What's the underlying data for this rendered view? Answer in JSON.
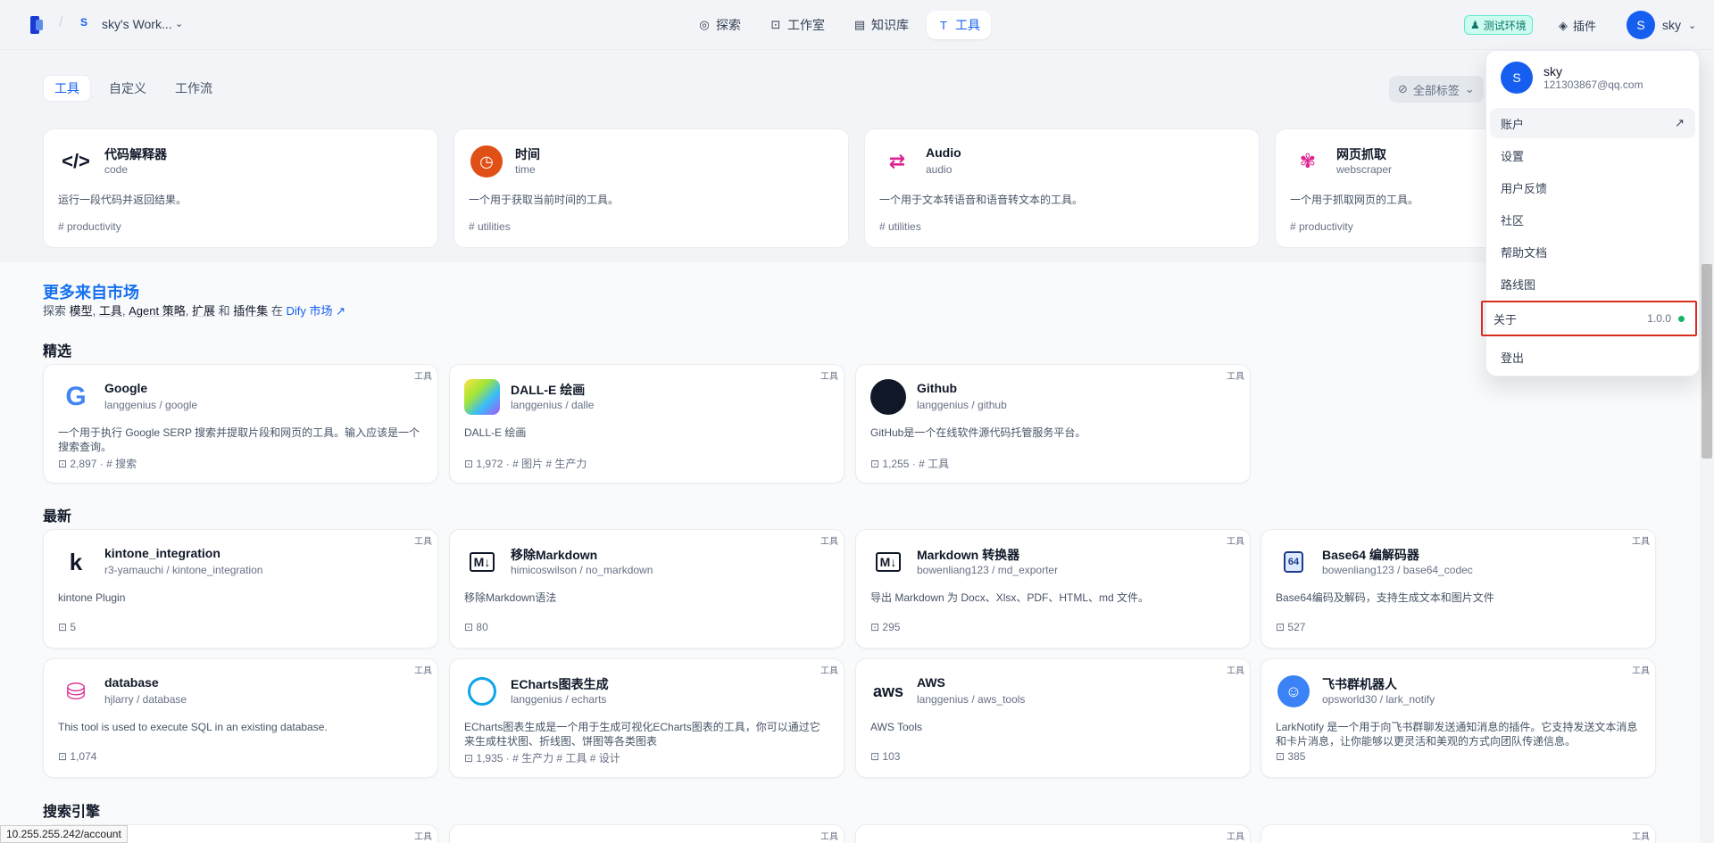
{
  "header": {
    "workspace_badge": "S",
    "workspace_name": "sky's Work...",
    "nav": [
      {
        "label": "探索",
        "icon": "explore-icon"
      },
      {
        "label": "工作室",
        "icon": "robot-icon"
      },
      {
        "label": "知识库",
        "icon": "book-icon"
      },
      {
        "label": "工具",
        "icon": "tool-icon"
      }
    ],
    "env_badge": "测试环境",
    "plugins_label": "插件",
    "user_initial": "S",
    "user_name": "sky"
  },
  "tabs": [
    "工具",
    "自定义",
    "工作流"
  ],
  "tag_filter": "全部标签",
  "installed_tools": [
    {
      "title": "代码解释器",
      "sub": "code",
      "desc": "运行一段代码并返回结果。",
      "tag": "# productivity",
      "icon": "</>",
      "color": "#101828"
    },
    {
      "title": "时间",
      "sub": "time",
      "desc": "一个用于获取当前时间的工具。",
      "tag": "# utilities",
      "icon": "◷",
      "color": "#e04f16"
    },
    {
      "title": "Audio",
      "sub": "audio",
      "desc": "一个用于文本转语音和语音转文本的工具。",
      "tag": "# utilities",
      "icon": "⇄",
      "color": "#dd2590"
    },
    {
      "title": "网页抓取",
      "sub": "webscraper",
      "desc": "一个用于抓取网页的工具。",
      "tag": "# productivity",
      "icon": "✾",
      "color": "#dd2590"
    }
  ],
  "market": {
    "title": "更多来自市场",
    "desc_prefix": "探索",
    "k1": "模型",
    "k2": "工具",
    "k3": "Agent 策略",
    "k4": "扩展",
    "and": "和",
    "k5": "插件集",
    "in": "在",
    "link": "Dify 市场 ↗",
    "sections": [
      "精选",
      "最新",
      "搜索引擎"
    ]
  },
  "featured": [
    {
      "title": "Google",
      "sub": "langgenius / google",
      "desc": "一个用于执行 Google SERP 搜索并提取片段和网页的工具。输入应该是一个搜索查询。",
      "meta": "⊡ 2,897 · # 搜索",
      "corner": "工具",
      "icon": "G",
      "color": "#4285f4"
    },
    {
      "title": "DALL-E 绘画",
      "sub": "langgenius / dalle",
      "desc": "DALL-E 绘画",
      "meta": "⊡ 1,972 · # 图片 # 生产力",
      "corner": "工具",
      "icon": "",
      "color": "#a3e635"
    },
    {
      "title": "Github",
      "sub": "langgenius / github",
      "desc": "GitHub是一个在线软件源代码托管服务平台。",
      "meta": "⊡ 1,255 · # 工具",
      "corner": "工具",
      "icon": "●",
      "color": "#101828"
    }
  ],
  "latest": [
    {
      "title": "kintone_integration",
      "sub": "r3-yamauchi / kintone_integration",
      "desc": "kintone Plugin",
      "meta": "⊡ 5",
      "corner": "工具",
      "icon": "k",
      "color": "#101828"
    },
    {
      "title": "移除Markdown",
      "sub": "himicoswilson / no_markdown",
      "desc": "移除Markdown语法",
      "meta": "⊡ 80",
      "corner": "工具",
      "icon": "M↓",
      "color": "#101828"
    },
    {
      "title": "Markdown 转换器",
      "sub": "bowenliang123 / md_exporter",
      "desc": "导出 Markdown 为 Docx、Xlsx、PDF、HTML、md 文件。",
      "meta": "⊡ 295",
      "corner": "工具",
      "icon": "M↓",
      "color": "#101828"
    },
    {
      "title": "Base64 编解码器",
      "sub": "bowenliang123 / base64_codec",
      "desc": "Base64编码及解码，支持生成文本和图片文件",
      "meta": "⊡ 527",
      "corner": "工具",
      "icon": "64",
      "color": "#1d4ed8"
    },
    {
      "title": "database",
      "sub": "hjlarry / database",
      "desc": "This tool is used to execute SQL in an existing database.",
      "meta": "⊡ 1,074",
      "corner": "工具",
      "icon": "DB",
      "color": "#dd2590"
    },
    {
      "title": "ECharts图表生成",
      "sub": "langgenius / echarts",
      "desc": "ECharts图表生成是一个用于生成可视化ECharts图表的工具，你可以通过它来生成柱状图、折线图、饼图等各类图表",
      "meta": "⊡ 1,935 · # 生产力 # 工具 # 设计",
      "corner": "工具",
      "icon": "◔",
      "color": "#0ea5e9"
    },
    {
      "title": "AWS",
      "sub": "langgenius / aws_tools",
      "desc": "AWS Tools",
      "meta": "⊡ 103",
      "corner": "工具",
      "icon": "aws",
      "color": "#101828"
    },
    {
      "title": "飞书群机器人",
      "sub": "opsworld30 / lark_notify",
      "desc": "LarkNotify 是一个用于向飞书群聊发送通知消息的插件。它支持发送文本消息和卡片消息，让你能够以更灵活和美观的方式向团队传递信息。",
      "meta": "⊡ 385",
      "corner": "工具",
      "icon": "☺",
      "color": "#3b82f6"
    }
  ],
  "search_cards_corner": "工具",
  "dropdown": {
    "initial": "S",
    "name": "sky",
    "email": "121303867@qq.com",
    "items": [
      "账户",
      "设置",
      "用户反馈",
      "社区",
      "帮助文档",
      "路线图",
      "关于",
      "登出"
    ],
    "account_arrow": "↗",
    "version": "1.0.0"
  },
  "status_url": "10.255.255.242/account"
}
